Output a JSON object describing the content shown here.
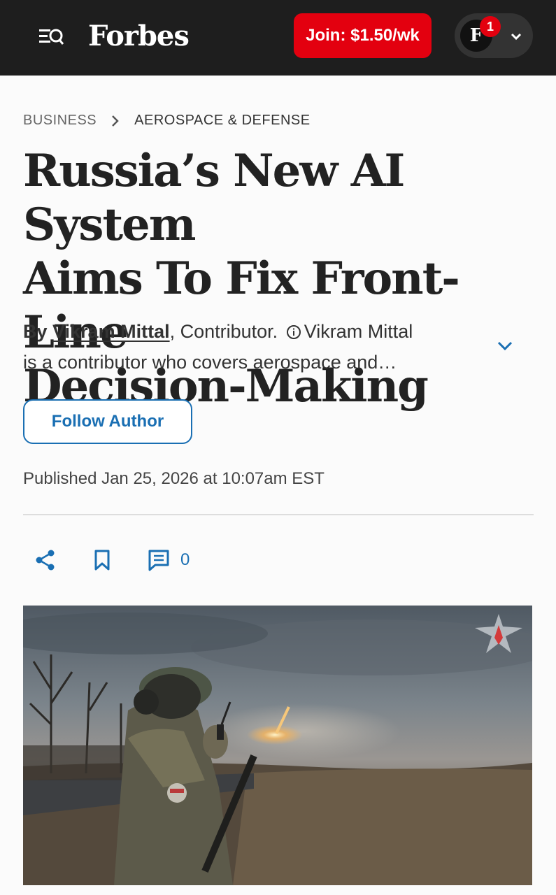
{
  "header": {
    "logo": "Forbes",
    "join_label": "Join: $1.50/wk",
    "avatar_letter": "F",
    "notification_count": "1"
  },
  "breadcrumb": {
    "section": "BUSINESS",
    "subsection": "AEROSPACE & DEFENSE"
  },
  "article": {
    "headline_lines": [
      "Russia’s New AI System",
      "Aims To Fix Front-Line",
      "Decision-Making"
    ],
    "by_label": "By",
    "author": "Vikram Mittal",
    "author_suffix": ", Contributor.",
    "bio_line1_tail": "Vikram Mittal",
    "bio_line2": "is a contributor who covers aerospace and…",
    "follow_label": "Follow Author",
    "published": "Published Jan 25, 2026 at 10:07am EST",
    "comment_count": "0"
  },
  "icons": {
    "menu": "menu-search-icon",
    "chevron": "chevron-down-icon",
    "info": "info-icon",
    "share": "share-icon",
    "bookmark": "bookmark-icon",
    "comment": "comment-icon",
    "watermark": "emblem-watermark-icon"
  },
  "colors": {
    "topbar": "#1e1e1e",
    "accent_red": "#e3000f",
    "link_blue": "#1a6fb3"
  }
}
